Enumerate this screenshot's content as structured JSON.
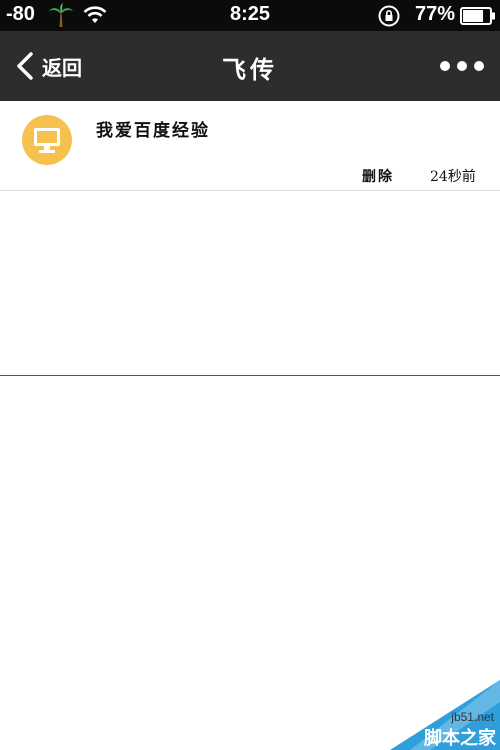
{
  "status_bar": {
    "signal": "-80",
    "carrier_icon": "palm-tree-icon",
    "wifi_icon": "wifi-icon",
    "time": "8:25",
    "rotation_lock_icon": "rotation-lock-icon",
    "battery_percent": "77%",
    "battery_level": 0.77
  },
  "nav": {
    "back_label": "返回",
    "title": "飞传",
    "more_icon": "more-dots-icon"
  },
  "messages": [
    {
      "avatar_icon": "computer-monitor-icon",
      "text": "我爱百度经验",
      "delete_label": "删除",
      "time": "24秒前"
    }
  ],
  "watermark": {
    "site": "jb51.net",
    "brand": "脚本之家"
  },
  "colors": {
    "nav_bg": "#2b2d2f",
    "status_bg": "#0b0b0b",
    "avatar_bg": "#f7c14f",
    "divider_red": "#c1282b",
    "watermark_blue": "#2f9fdc"
  }
}
